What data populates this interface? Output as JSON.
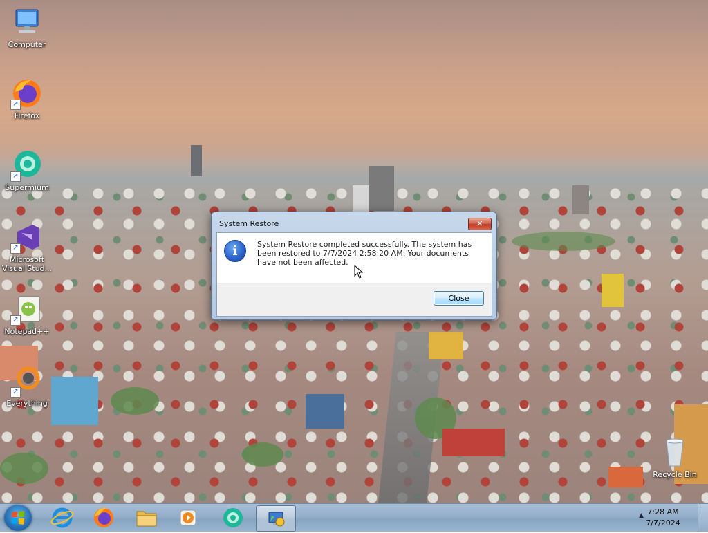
{
  "desktop": {
    "icons": [
      {
        "label": "Computer",
        "icon": "computer-icon"
      },
      {
        "label": "Firefox",
        "icon": "firefox-icon"
      },
      {
        "label": "Supermium",
        "icon": "supermium-icon"
      },
      {
        "label": "Microsoft Visual Stud...",
        "icon": "visual-studio-icon"
      },
      {
        "label": "Notepad++",
        "icon": "notepad-plus-plus-icon"
      },
      {
        "label": "Everything",
        "icon": "everything-icon"
      },
      {
        "label": "Recycle Bin",
        "icon": "recycle-bin-icon"
      }
    ]
  },
  "dialog": {
    "title": "System Restore",
    "close_glyph": "✕",
    "info_glyph": "i",
    "message": "System Restore completed successfully. The system has been restored to 7/7/2024 2:58:20 AM. Your documents have not been affected.",
    "button_label": "Close"
  },
  "taskbar": {
    "items": [
      {
        "name": "start-button",
        "icon": "windows-logo-icon"
      },
      {
        "name": "internet-explorer",
        "icon": "internet-explorer-icon"
      },
      {
        "name": "firefox",
        "icon": "firefox-icon"
      },
      {
        "name": "file-explorer",
        "icon": "folder-icon"
      },
      {
        "name": "media-player",
        "icon": "media-player-icon"
      },
      {
        "name": "supermium",
        "icon": "supermium-icon"
      },
      {
        "name": "system-restore",
        "icon": "system-restore-icon",
        "active": true
      }
    ],
    "clock_time": "7:28 AM",
    "clock_date": "7/7/2024",
    "tray_arrow": "▲"
  }
}
